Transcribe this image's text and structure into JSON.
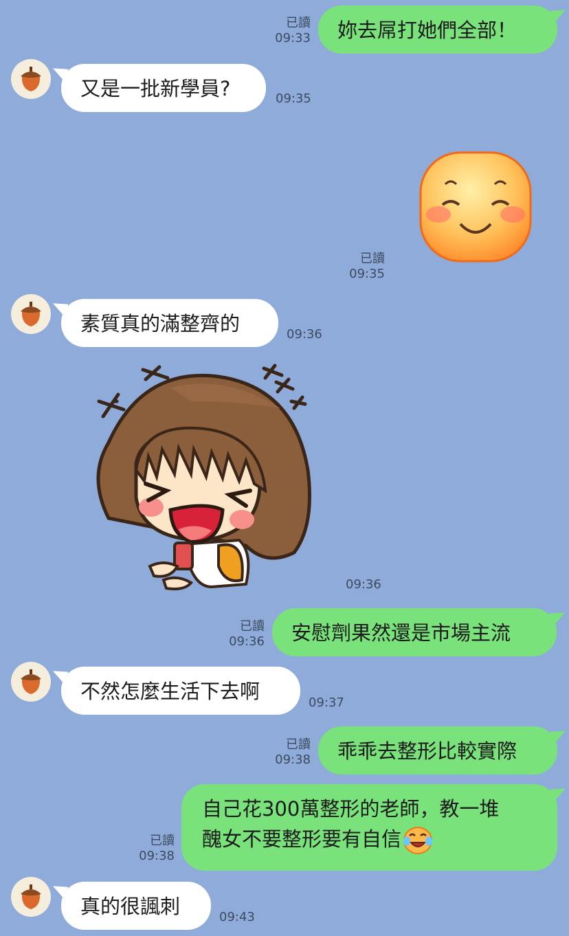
{
  "messages": [
    {
      "id": "m1",
      "direction": "out",
      "text": "妳去屌打她們全部！",
      "read": "已讀",
      "time": "09:33"
    },
    {
      "id": "m2",
      "direction": "in",
      "text": "又是一批新學員?",
      "time": "09:35"
    },
    {
      "id": "m3",
      "direction": "out",
      "sticker": "smiling-face-sticker",
      "read": "已讀",
      "time": "09:35"
    },
    {
      "id": "m4",
      "direction": "in",
      "text": "素質真的滿整齊的",
      "time": "09:36"
    },
    {
      "id": "m5",
      "direction": "in",
      "sticker": "laughing-girl-sticker",
      "time": "09:36"
    },
    {
      "id": "m6",
      "direction": "out",
      "text": "安慰劑果然還是市場主流",
      "read": "已讀",
      "time": "09:36"
    },
    {
      "id": "m7",
      "direction": "in",
      "text": "不然怎麼生活下去啊",
      "time": "09:37"
    },
    {
      "id": "m8",
      "direction": "out",
      "text": "乖乖去整形比較實際",
      "read": "已讀",
      "time": "09:38"
    },
    {
      "id": "m9",
      "direction": "out",
      "lines": [
        "自己花300萬整形的老師，教一堆",
        "醜女不要整形要有自信"
      ],
      "emoji": "tears-of-joy-emoji",
      "read": "已讀",
      "time": "09:38"
    },
    {
      "id": "m10",
      "direction": "in",
      "text": "真的很諷刺",
      "time": "09:43"
    }
  ],
  "contact": {
    "avatar_icon": "acorn-icon"
  },
  "colors": {
    "background": "#8eabd9",
    "outgoing": "#79e27a",
    "incoming": "#ffffff"
  }
}
